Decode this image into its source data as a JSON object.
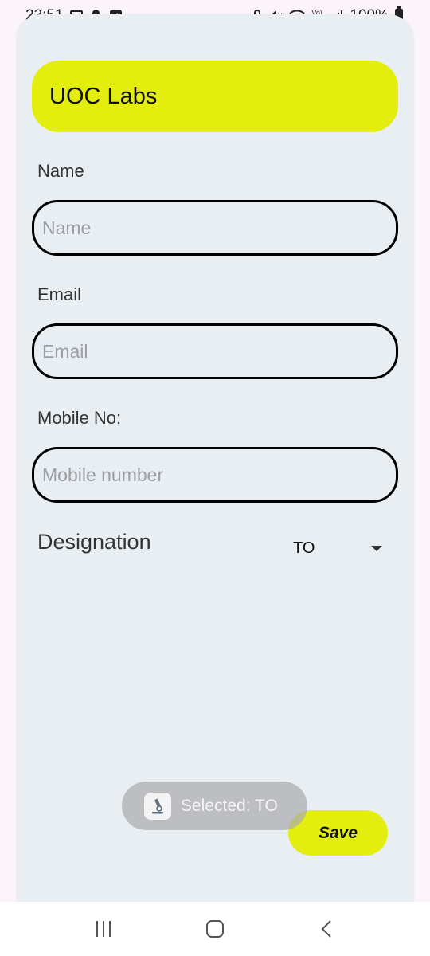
{
  "status_bar": {
    "time": "23:51",
    "battery": "100%",
    "network": "Vo) LTE"
  },
  "header": {
    "title": "UOC Labs",
    "color": "#e3ee0f"
  },
  "form": {
    "name": {
      "label": "Name",
      "placeholder": "Name",
      "value": ""
    },
    "email": {
      "label": "Email",
      "placeholder": "Email",
      "value": ""
    },
    "mobile": {
      "label": "Mobile No:",
      "placeholder": "Mobile number",
      "value": ""
    },
    "designation": {
      "label": "Designation",
      "selected": "TO"
    }
  },
  "save_button": {
    "label": "Save"
  },
  "toast": {
    "text": "Selected: TO",
    "icon": "microscope-icon"
  },
  "nav": {
    "recents_icon": "recents-icon",
    "home_icon": "home-icon",
    "back_icon": "back-icon"
  }
}
